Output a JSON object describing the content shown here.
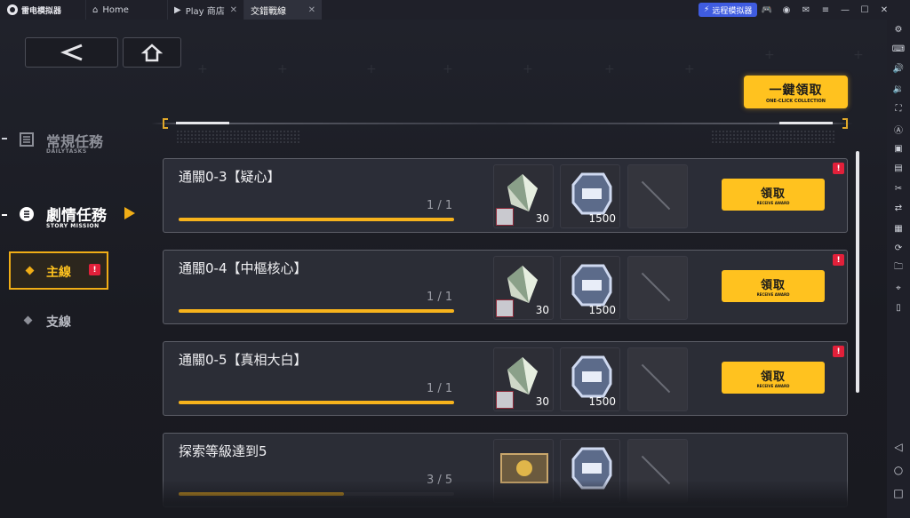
{
  "emulator": {
    "brand": "雷电模拟器",
    "tabs": [
      {
        "label": "Home",
        "icon": "home-icon"
      },
      {
        "label": "Play 商店",
        "icon": "play-store-icon"
      },
      {
        "label": "交錯戰線",
        "icon": "game-icon",
        "active": true
      }
    ],
    "remote_button": "远程模拟器",
    "toolbar_icons": [
      "gamepad-icon",
      "account-icon",
      "mail-icon",
      "menu-icon",
      "minimize-icon",
      "maximize-icon",
      "close-icon"
    ],
    "sidebar_icons": [
      "settings-icon",
      "keyboard-icon",
      "volume-up-icon",
      "volume-down-icon",
      "fullscreen-icon",
      "translate-icon",
      "video-icon",
      "apk-icon",
      "scissors-icon",
      "sync-icon",
      "notes-icon",
      "rotate-icon",
      "folder-icon",
      "location-icon",
      "shake-icon"
    ],
    "nav_buttons": [
      "back-triangle-icon",
      "home-circle-icon",
      "recent-square-icon"
    ]
  },
  "header": {
    "one_click_label": "一鍵領取",
    "one_click_sub": "ONE-CLICK COLLECTION"
  },
  "nav": {
    "daily_title": "常規任務",
    "daily_sub": "DAILYTASKS",
    "story_title": "劇情任務",
    "story_sub": "STORY MISSION",
    "main_line": "主線",
    "side_line": "支線",
    "alert": "!"
  },
  "missions": [
    {
      "title": "通關0-3【疑心】",
      "progress": "1 / 1",
      "progress_fraction": 1.0,
      "reward1_qty": "30",
      "reward2_qty": "1500",
      "button": "領取",
      "button_sub": "RECEIVE AWARD",
      "alert": "!"
    },
    {
      "title": "通關0-4【中樞核心】",
      "progress": "1 / 1",
      "progress_fraction": 1.0,
      "reward1_qty": "30",
      "reward2_qty": "1500",
      "button": "領取",
      "button_sub": "RECEIVE AWARD",
      "alert": "!"
    },
    {
      "title": "通關0-5【真相大白】",
      "progress": "1 / 1",
      "progress_fraction": 1.0,
      "reward1_qty": "30",
      "reward2_qty": "1500",
      "button": "領取",
      "button_sub": "RECEIVE AWARD",
      "alert": "!"
    },
    {
      "title": "探索等級達到5",
      "progress": "3 / 5",
      "progress_fraction": 0.6
    }
  ],
  "colors": {
    "accent": "#ffc21f",
    "alert": "#e2203a",
    "emulator_bar": "#1f2029",
    "remote_button": "#3f5ce0"
  }
}
